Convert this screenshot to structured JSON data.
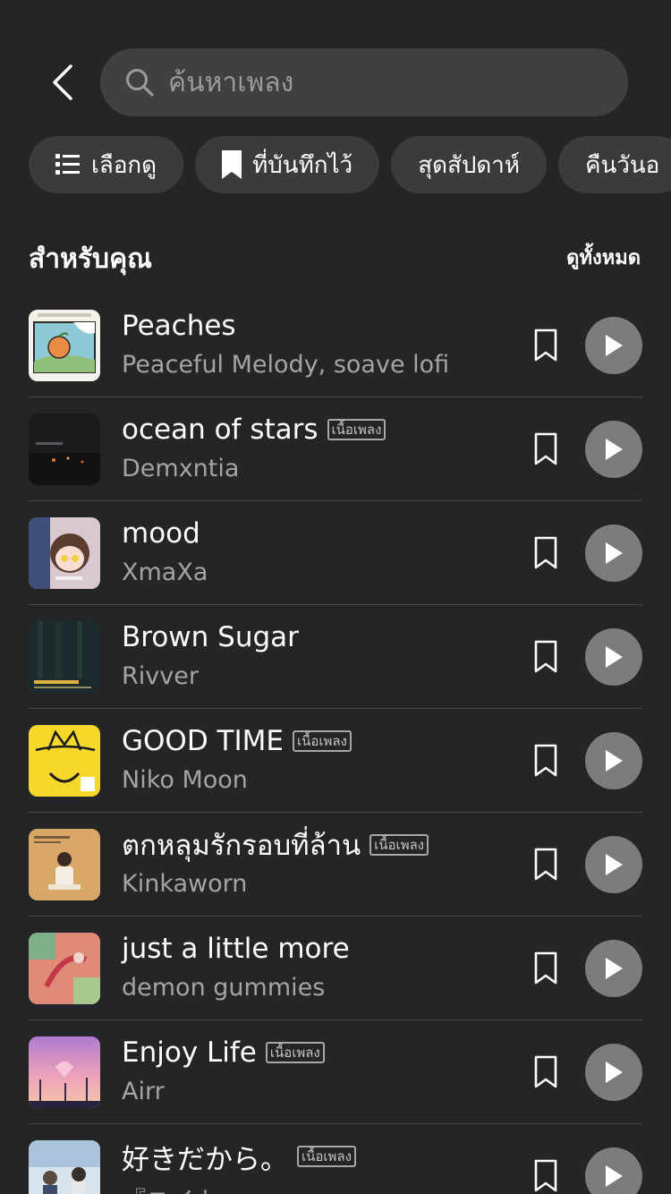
{
  "search": {
    "placeholder": "ค้นหาเพลง"
  },
  "chips": [
    {
      "label": "เลือกดู",
      "icon": "list-icon"
    },
    {
      "label": "ที่บันทึกไว้",
      "icon": "bookmark-icon"
    },
    {
      "label": "สุดสัปดาห์"
    },
    {
      "label": "คืนวันอ"
    }
  ],
  "section": {
    "title": "สำหรับคุณ",
    "see_all": "ดูทั้งหมด"
  },
  "lyrics_badge": "เนื้อเพลง",
  "songs": [
    {
      "title": "Peaches",
      "artist": "Peaceful Melody, soave lofi",
      "lyrics": false
    },
    {
      "title": "ocean of stars",
      "artist": "Demxntia",
      "lyrics": true
    },
    {
      "title": "mood",
      "artist": "XmaXa",
      "lyrics": false
    },
    {
      "title": "Brown Sugar",
      "artist": "Rivver",
      "lyrics": false
    },
    {
      "title": "GOOD TIME",
      "artist": "Niko Moon",
      "lyrics": true
    },
    {
      "title": "ตกหลุมรักรอบที่ล้าน",
      "artist": "Kinkaworn",
      "lyrics": true
    },
    {
      "title": "just a little more",
      "artist": "demon gummies",
      "lyrics": false
    },
    {
      "title": "Enjoy Life",
      "artist": "Airr",
      "lyrics": true
    },
    {
      "title": "好きだから。",
      "artist": "『ユイカ",
      "lyrics": true
    }
  ],
  "colors": {
    "background": "#242527",
    "search_bg": "#3f4042",
    "chip_bg": "#3a3b3d",
    "play_bg": "#7b7c7e",
    "secondary_text": "#a3a4a6"
  }
}
